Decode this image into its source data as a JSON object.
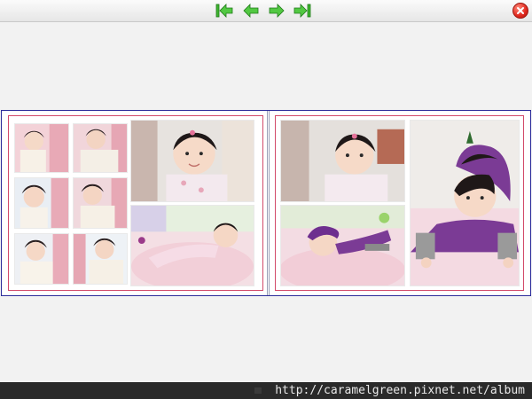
{
  "navigation": {
    "first_icon": "first-page-icon",
    "prev_icon": "previous-page-icon",
    "next_icon": "next-page-icon",
    "last_icon": "last-page-icon",
    "close_icon": "close-icon",
    "icon_color": "#3fb531"
  },
  "footer": {
    "url": "http://caramelgreen.pixnet.net/album"
  },
  "colors": {
    "album_border": "#2b2b9a",
    "page_frame": "#d24a6a",
    "footer_bg": "#2a2a2a"
  }
}
